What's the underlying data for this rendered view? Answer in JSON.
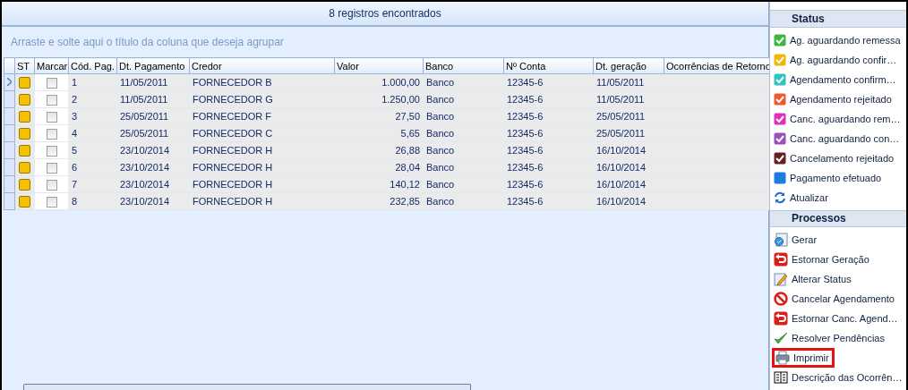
{
  "header": {
    "title": "8 registros encontrados"
  },
  "group_panel": {
    "hint": "Arraste e solte aqui o título da coluna que deseja agrupar"
  },
  "table": {
    "columns": [
      "ST",
      "Marcar",
      "Cód. Pag.",
      "Dt. Pagamento",
      "Credor",
      "Valor",
      "Banco",
      "Nº Conta",
      "Dt. geração",
      "Ocorrências de Retorno"
    ],
    "rows": [
      {
        "selected": true,
        "color": "#f2c200",
        "checked": false,
        "cells": [
          "",
          "",
          "1",
          "11/05/2011",
          "FORNECEDOR B",
          "1.000,00",
          "Banco",
          "12345-6",
          "11/05/2011",
          ""
        ]
      },
      {
        "selected": false,
        "color": "#f2c200",
        "checked": false,
        "cells": [
          "",
          "",
          "2",
          "11/05/2011",
          "FORNECEDOR G",
          "1.250,00",
          "Banco",
          "12345-6",
          "11/05/2011",
          ""
        ]
      },
      {
        "selected": false,
        "color": "#f2c200",
        "checked": false,
        "cells": [
          "",
          "",
          "3",
          "25/05/2011",
          "FORNECEDOR F",
          "27,50",
          "Banco",
          "12345-6",
          "25/05/2011",
          ""
        ]
      },
      {
        "selected": false,
        "color": "#f2c200",
        "checked": false,
        "cells": [
          "",
          "",
          "4",
          "25/05/2011",
          "FORNECEDOR C",
          "5,65",
          "Banco",
          "12345-6",
          "25/05/2011",
          ""
        ]
      },
      {
        "selected": false,
        "color": "#f2c200",
        "checked": false,
        "cells": [
          "",
          "",
          "5",
          "23/10/2014",
          "FORNECEDOR H",
          "26,88",
          "Banco",
          "12345-6",
          "16/10/2014",
          ""
        ]
      },
      {
        "selected": false,
        "color": "#f2c200",
        "checked": false,
        "cells": [
          "",
          "",
          "6",
          "23/10/2014",
          "FORNECEDOR H",
          "28,04",
          "Banco",
          "12345-6",
          "16/10/2014",
          ""
        ]
      },
      {
        "selected": false,
        "color": "#f2c200",
        "checked": false,
        "cells": [
          "",
          "",
          "7",
          "23/10/2014",
          "FORNECEDOR H",
          "140,12",
          "Banco",
          "12345-6",
          "16/10/2014",
          ""
        ]
      },
      {
        "selected": false,
        "color": "#f2c200",
        "checked": false,
        "cells": [
          "",
          "",
          "8",
          "23/10/2014",
          "FORNECEDOR H",
          "232,85",
          "Banco",
          "12345-6",
          "16/10/2014",
          ""
        ]
      }
    ]
  },
  "side_panel": {
    "sections": [
      {
        "title": "Status",
        "items": [
          {
            "label": "Ag. aguardando remessa",
            "kind": "check",
            "color": "#3cb83c"
          },
          {
            "label": "Ag. aguardando confir…",
            "kind": "check",
            "color": "#f0b800"
          },
          {
            "label": "Agendamento confirm…",
            "kind": "check",
            "color": "#2ec4c4"
          },
          {
            "label": "Agendamento rejeitado",
            "kind": "check",
            "color": "#f05a30"
          },
          {
            "label": "Canc. aguardando rem…",
            "kind": "check",
            "color": "#e030b8"
          },
          {
            "label": "Canc. aguardando con…",
            "kind": "check",
            "color": "#9a50b8"
          },
          {
            "label": "Cancelamento rejeitado",
            "kind": "check",
            "color": "#6a2020"
          },
          {
            "label": "Pagamento efetuado",
            "kind": "square",
            "color": "#1e7be0"
          },
          {
            "label": "Atualizar",
            "kind": "refresh",
            "color": "#1e6fd0"
          }
        ]
      },
      {
        "title": "Processos",
        "items": [
          {
            "label": "Gerar",
            "kind": "document",
            "highlighted": false
          },
          {
            "label": "Estornar Geração",
            "kind": "undo",
            "highlighted": false
          },
          {
            "label": "Alterar Status",
            "kind": "edit",
            "highlighted": false
          },
          {
            "label": "Cancelar Agendamento",
            "kind": "forbid",
            "highlighted": false
          },
          {
            "label": "Estornar Canc. Agend…",
            "kind": "undo",
            "highlighted": false
          },
          {
            "label": "Resolver Pendências",
            "kind": "tick",
            "highlighted": false
          },
          {
            "label": "Imprimir",
            "kind": "printer",
            "highlighted": true
          },
          {
            "label": "Descrição das Ocorrên…",
            "kind": "book",
            "highlighted": false
          }
        ]
      }
    ]
  }
}
